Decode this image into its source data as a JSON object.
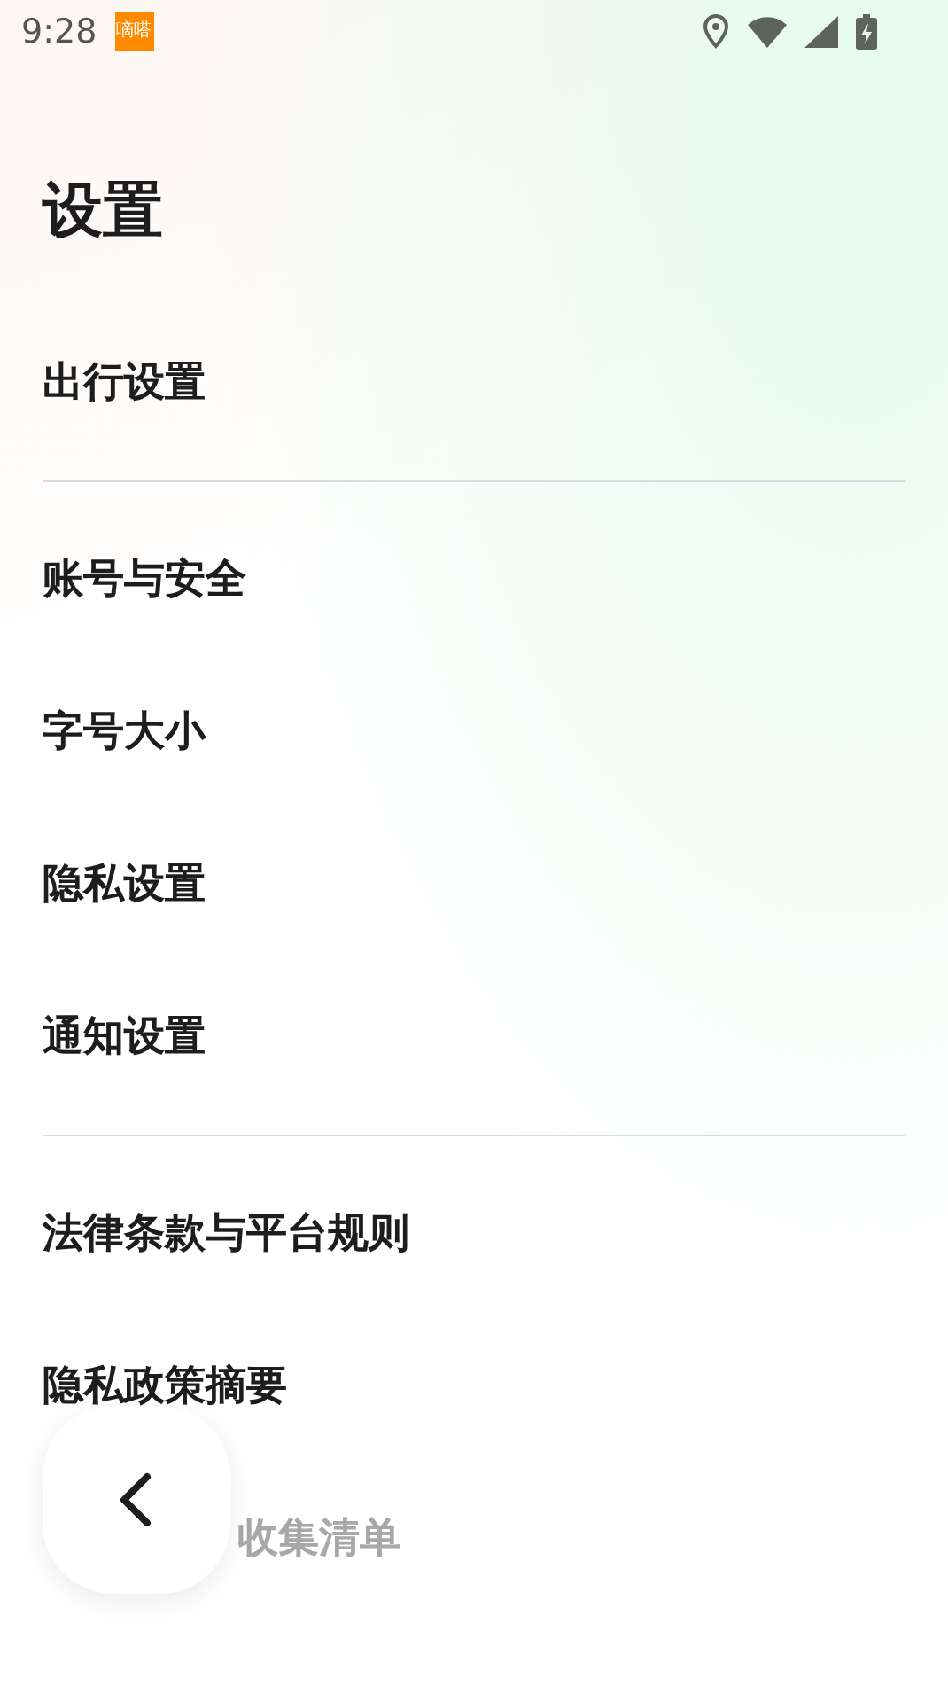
{
  "status_bar": {
    "time": "9:28",
    "app_badge": "嘀嗒"
  },
  "title": "设置",
  "sections": [
    {
      "items": [
        {
          "label": "出行设置",
          "faded": false
        }
      ]
    },
    {
      "items": [
        {
          "label": "账号与安全",
          "faded": false
        },
        {
          "label": "字号大小",
          "faded": false
        },
        {
          "label": "隐私设置",
          "faded": false
        },
        {
          "label": "通知设置",
          "faded": false
        }
      ]
    },
    {
      "items": [
        {
          "label": "法律条款与平台规则",
          "faded": false
        },
        {
          "label": "隐私政策摘要",
          "faded": false
        },
        {
          "label": "收集清单",
          "faded": true
        }
      ]
    }
  ]
}
